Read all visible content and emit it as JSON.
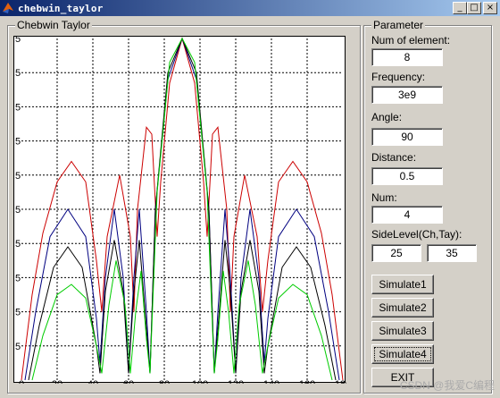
{
  "window": {
    "title": "chebwin_taylor",
    "minimize_glyph": "_",
    "maximize_glyph": "□",
    "close_glyph": "×"
  },
  "plot_panel": {
    "legend": "Chebwin Taylor"
  },
  "params": {
    "legend": "Parameter",
    "num_elements": {
      "label": "Num of element:",
      "value": "8"
    },
    "frequency": {
      "label": "Frequency:",
      "value": "3e9"
    },
    "angle": {
      "label": "Angle:",
      "value": "90"
    },
    "distance": {
      "label": "Distance:",
      "value": "0.5"
    },
    "num": {
      "label": "Num:",
      "value": "4"
    },
    "sidelevel": {
      "label": "SideLevel(Ch,Tay):",
      "value_ch": "25",
      "value_tay": "35"
    }
  },
  "buttons": {
    "simulate1": "Simulate1",
    "simulate2": "Simulate2",
    "simulate3": "Simulate3",
    "simulate4": "Simulate4",
    "exit": "EXIT"
  },
  "watermark": "CSDN @我爱C编程",
  "chart_data": {
    "type": "line",
    "xlim": [
      0,
      180
    ],
    "ylim": [
      0,
      1
    ],
    "x_ticks": [
      0,
      20,
      40,
      60,
      80,
      100,
      120,
      140,
      160,
      180
    ],
    "y_tick_labels": [
      ".5",
      ".5",
      ".5",
      ".5",
      ".5",
      ".5",
      ".5",
      ".5",
      ".5",
      ".5"
    ],
    "grid": true,
    "series": [
      {
        "color": "#cc0000",
        "points": [
          [
            0,
            0
          ],
          [
            6,
            0.25
          ],
          [
            12,
            0.43
          ],
          [
            20,
            0.58
          ],
          [
            28,
            0.64
          ],
          [
            36,
            0.58
          ],
          [
            42,
            0.35
          ],
          [
            45,
            0.2
          ],
          [
            48,
            0.42
          ],
          [
            55,
            0.6
          ],
          [
            61,
            0.42
          ],
          [
            63,
            0.2
          ],
          [
            65,
            0.5
          ],
          [
            70,
            0.74
          ],
          [
            73,
            0.72
          ],
          [
            76,
            0.42
          ],
          [
            78,
            0.58
          ],
          [
            83,
            0.87
          ],
          [
            90,
            1.0
          ],
          [
            97,
            0.87
          ],
          [
            102,
            0.58
          ],
          [
            104,
            0.42
          ],
          [
            107,
            0.72
          ],
          [
            110,
            0.74
          ],
          [
            115,
            0.5
          ],
          [
            117,
            0.2
          ],
          [
            119,
            0.42
          ],
          [
            125,
            0.6
          ],
          [
            132,
            0.42
          ],
          [
            135,
            0.2
          ],
          [
            138,
            0.35
          ],
          [
            144,
            0.58
          ],
          [
            152,
            0.64
          ],
          [
            160,
            0.58
          ],
          [
            168,
            0.43
          ],
          [
            174,
            0.25
          ],
          [
            180,
            0
          ]
        ]
      },
      {
        "color": "#000080",
        "points": [
          [
            2,
            0
          ],
          [
            8,
            0.2
          ],
          [
            16,
            0.42
          ],
          [
            26,
            0.5
          ],
          [
            36,
            0.42
          ],
          [
            42,
            0.18
          ],
          [
            44,
            0.05
          ],
          [
            47,
            0.3
          ],
          [
            52,
            0.5
          ],
          [
            57,
            0.3
          ],
          [
            60,
            0.02
          ],
          [
            63,
            0.3
          ],
          [
            66,
            0.5
          ],
          [
            70,
            0.2
          ],
          [
            72,
            0.02
          ],
          [
            75,
            0.5
          ],
          [
            82,
            0.88
          ],
          [
            90,
            1.0
          ],
          [
            98,
            0.88
          ],
          [
            105,
            0.5
          ],
          [
            108,
            0.02
          ],
          [
            110,
            0.2
          ],
          [
            114,
            0.5
          ],
          [
            117,
            0.3
          ],
          [
            120,
            0.02
          ],
          [
            123,
            0.3
          ],
          [
            128,
            0.5
          ],
          [
            133,
            0.3
          ],
          [
            136,
            0.05
          ],
          [
            138,
            0.18
          ],
          [
            144,
            0.42
          ],
          [
            154,
            0.5
          ],
          [
            164,
            0.42
          ],
          [
            172,
            0.2
          ],
          [
            178,
            0
          ]
        ]
      },
      {
        "color": "#000000",
        "points": [
          [
            4,
            0
          ],
          [
            10,
            0.16
          ],
          [
            18,
            0.33
          ],
          [
            26,
            0.39
          ],
          [
            34,
            0.33
          ],
          [
            42,
            0.1
          ],
          [
            44,
            0.02
          ],
          [
            47,
            0.26
          ],
          [
            52,
            0.41
          ],
          [
            57,
            0.26
          ],
          [
            60,
            0.02
          ],
          [
            63,
            0.26
          ],
          [
            66,
            0.41
          ],
          [
            70,
            0.15
          ],
          [
            72,
            0.02
          ],
          [
            75,
            0.5
          ],
          [
            82,
            0.9
          ],
          [
            90,
            1.0
          ],
          [
            98,
            0.9
          ],
          [
            105,
            0.5
          ],
          [
            108,
            0.02
          ],
          [
            110,
            0.15
          ],
          [
            114,
            0.41
          ],
          [
            117,
            0.26
          ],
          [
            120,
            0.02
          ],
          [
            123,
            0.26
          ],
          [
            128,
            0.41
          ],
          [
            133,
            0.26
          ],
          [
            136,
            0.02
          ],
          [
            138,
            0.1
          ],
          [
            146,
            0.33
          ],
          [
            154,
            0.39
          ],
          [
            162,
            0.33
          ],
          [
            170,
            0.16
          ],
          [
            176,
            0
          ]
        ]
      },
      {
        "color": "#00cc00",
        "points": [
          [
            6,
            0
          ],
          [
            12,
            0.13
          ],
          [
            20,
            0.25
          ],
          [
            28,
            0.28
          ],
          [
            36,
            0.24
          ],
          [
            42,
            0.1
          ],
          [
            45,
            0.02
          ],
          [
            49,
            0.22
          ],
          [
            53,
            0.35
          ],
          [
            58,
            0.22
          ],
          [
            61,
            0.02
          ],
          [
            64,
            0.2
          ],
          [
            67,
            0.32
          ],
          [
            70,
            0.12
          ],
          [
            72,
            0.02
          ],
          [
            76,
            0.55
          ],
          [
            83,
            0.93
          ],
          [
            90,
            1.0
          ],
          [
            97,
            0.93
          ],
          [
            104,
            0.55
          ],
          [
            108,
            0.02
          ],
          [
            110,
            0.12
          ],
          [
            113,
            0.32
          ],
          [
            116,
            0.2
          ],
          [
            119,
            0.02
          ],
          [
            122,
            0.22
          ],
          [
            127,
            0.35
          ],
          [
            131,
            0.22
          ],
          [
            135,
            0.02
          ],
          [
            138,
            0.1
          ],
          [
            144,
            0.24
          ],
          [
            152,
            0.28
          ],
          [
            160,
            0.25
          ],
          [
            168,
            0.13
          ],
          [
            174,
            0
          ]
        ]
      }
    ]
  }
}
